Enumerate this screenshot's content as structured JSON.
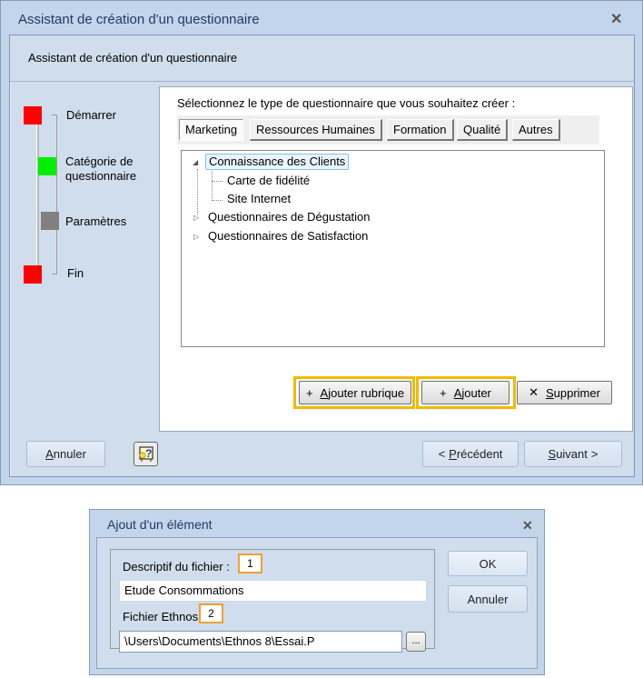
{
  "wizard": {
    "window_title": "Assistant de création d'un questionnaire",
    "header_text": "Assistant de création d'un questionnaire",
    "close_icon": "close-icon",
    "steps": [
      {
        "label": "Démarrer",
        "status_color": "#ff0000"
      },
      {
        "label": "Catégorie de questionnaire",
        "status_color": "#00ee00"
      },
      {
        "label": "Paramètres",
        "status_color": "#808080"
      },
      {
        "label": "Fin",
        "status_color": "#ff0000"
      }
    ],
    "prompt": "Sélectionnez le type de questionnaire que vous souhaitez créer :",
    "tabs": [
      {
        "label": "Marketing",
        "active": true
      },
      {
        "label": "Ressources Humaines",
        "active": false
      },
      {
        "label": "Formation",
        "active": false
      },
      {
        "label": "Qualité",
        "active": false
      },
      {
        "label": "Autres",
        "active": false
      }
    ],
    "tree": [
      {
        "label": "Connaissance des Clients",
        "expanded": true,
        "selected": true,
        "children": [
          {
            "label": "Carte de fidélité"
          },
          {
            "label": "Site Internet"
          }
        ]
      },
      {
        "label": "Questionnaires de Dégustation",
        "expanded": false
      },
      {
        "label": "Questionnaires de Satisfaction",
        "expanded": false
      }
    ],
    "actions": {
      "add_section": {
        "icon": "+",
        "label": "Ajouter rubrique"
      },
      "add": {
        "icon": "+",
        "label": "Ajouter"
      },
      "delete": {
        "icon": "✕",
        "label": "Supprimer"
      }
    },
    "footer": {
      "cancel": "Annuler",
      "help_icon": "help-icon",
      "previous": "Précédent",
      "next": "Suivant",
      "prev_glyph": "<",
      "next_glyph": ">"
    },
    "highlight_color": "#f5b800"
  },
  "dialog": {
    "window_title": "Ajout d'un élément",
    "fields": [
      {
        "label": "Descriptif du fichier :",
        "badge": "1",
        "value": "Etude Consommations"
      },
      {
        "label": "Fichier Ethnos :",
        "badge": "2",
        "value": "\\Users\\Documents\\Ethnos 8\\Essai.P",
        "browse": "..."
      }
    ],
    "ok": "OK",
    "cancel": "Annuler",
    "badge_color": "#f0a030"
  }
}
